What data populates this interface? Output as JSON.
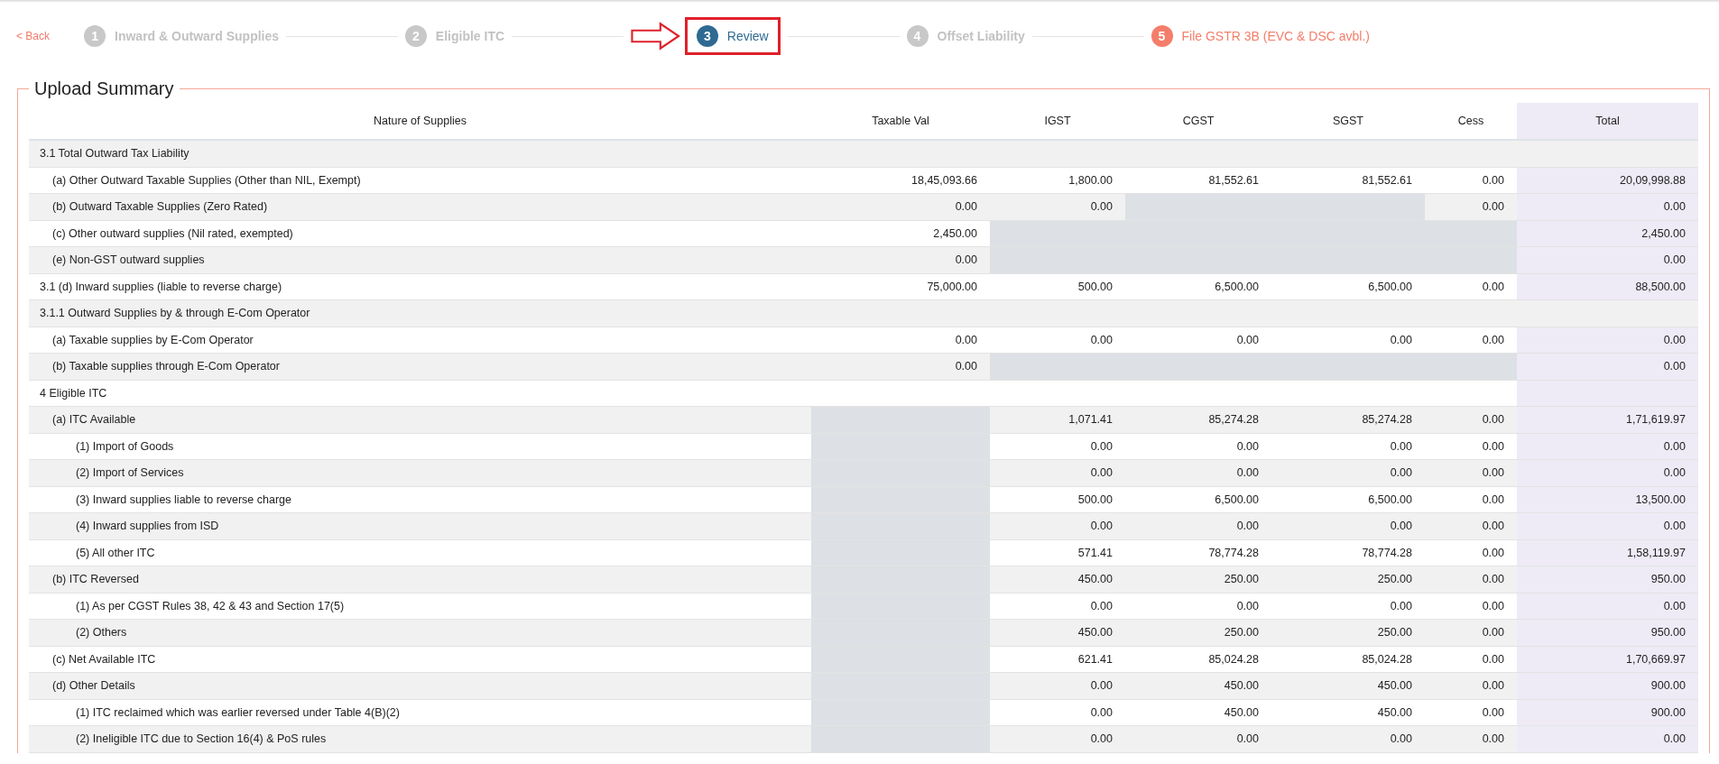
{
  "back": {
    "label": "< Back"
  },
  "steps": [
    {
      "number": "1",
      "label": "Inward & Outward Supplies",
      "kind": "pending",
      "highlighted": false
    },
    {
      "number": "2",
      "label": "Eligible ITC",
      "kind": "pending",
      "highlighted": false
    },
    {
      "number": "3",
      "label": "Review",
      "kind": "current",
      "highlighted": true
    },
    {
      "number": "4",
      "label": "Offset Liability",
      "kind": "pending",
      "highlighted": false
    },
    {
      "number": "5",
      "label": "File GSTR 3B (EVC & DSC avbl.)",
      "kind": "final",
      "highlighted": false
    }
  ],
  "summary": {
    "title": "Upload Summary",
    "columns": [
      "Nature of Supplies",
      "Taxable Val",
      "IGST",
      "CGST",
      "SGST",
      "Cess",
      "Total"
    ],
    "rows": [
      {
        "label": "3.1 Total Outward Tax Liability",
        "children": [
          {
            "label": "(a) Other Outward Taxable Supplies (Other than NIL, Exempt)",
            "cells": [
              {
                "text": "18,45,093.66",
                "disabled": false
              },
              {
                "text": "1,800.00",
                "disabled": false
              },
              {
                "text": "81,552.61",
                "disabled": false
              },
              {
                "text": "81,552.61",
                "disabled": false
              },
              {
                "text": "0.00",
                "disabled": false
              },
              {
                "text": "20,09,998.88",
                "disabled": false
              }
            ]
          },
          {
            "label": "(b) Outward Taxable Supplies (Zero Rated)",
            "cells": [
              {
                "text": "0.00",
                "disabled": false
              },
              {
                "text": "0.00",
                "disabled": false
              },
              {
                "disabled": true
              },
              {
                "disabled": true
              },
              {
                "text": "0.00",
                "disabled": false
              },
              {
                "text": "0.00",
                "disabled": false
              }
            ]
          },
          {
            "label": "(c) Other outward supplies (Nil rated, exempted)",
            "cells": [
              {
                "text": "2,450.00",
                "disabled": false
              },
              {
                "disabled": true
              },
              {
                "disabled": true
              },
              {
                "disabled": true
              },
              {
                "disabled": true
              },
              {
                "text": "2,450.00",
                "disabled": false
              }
            ]
          },
          {
            "label": "(e) Non-GST outward supplies",
            "cells": [
              {
                "text": "0.00",
                "disabled": false
              },
              {
                "disabled": true
              },
              {
                "disabled": true
              },
              {
                "disabled": true
              },
              {
                "disabled": true
              },
              {
                "text": "0.00",
                "disabled": false
              }
            ]
          }
        ]
      },
      {
        "label": "3.1 (d) Inward supplies (liable to reverse charge)",
        "cells": [
          {
            "text": "75,000.00",
            "disabled": false
          },
          {
            "text": "500.00",
            "disabled": false
          },
          {
            "text": "6,500.00",
            "disabled": false
          },
          {
            "text": "6,500.00",
            "disabled": false
          },
          {
            "text": "0.00",
            "disabled": false
          },
          {
            "text": "88,500.00",
            "disabled": false
          }
        ]
      },
      {
        "label": "3.1.1 Outward Supplies by & through E-Com Operator",
        "children": [
          {
            "label": "(a) Taxable supplies by E-Com Operator",
            "cells": [
              {
                "text": "0.00",
                "disabled": false
              },
              {
                "text": "0.00",
                "disabled": false
              },
              {
                "text": "0.00",
                "disabled": false
              },
              {
                "text": "0.00",
                "disabled": false
              },
              {
                "text": "0.00",
                "disabled": false
              },
              {
                "text": "0.00",
                "disabled": false
              }
            ]
          },
          {
            "label": "(b) Taxable supplies through E-Com Operator",
            "cells": [
              {
                "text": "0.00",
                "disabled": false
              },
              {
                "disabled": true
              },
              {
                "disabled": true
              },
              {
                "disabled": true
              },
              {
                "disabled": true
              },
              {
                "text": "0.00",
                "disabled": false
              }
            ]
          }
        ]
      },
      {
        "label": "4 Eligible ITC",
        "children": [
          {
            "label": "(a) ITC Available",
            "cells": [
              {
                "disabled": true
              },
              {
                "text": "1,071.41",
                "disabled": false
              },
              {
                "text": "85,274.28",
                "disabled": false
              },
              {
                "text": "85,274.28",
                "disabled": false
              },
              {
                "text": "0.00",
                "disabled": false
              },
              {
                "text": "1,71,619.97",
                "disabled": false
              }
            ],
            "children": [
              {
                "label": "(1) Import of Goods",
                "cells": [
                  {
                    "disabled": true
                  },
                  {
                    "text": "0.00",
                    "disabled": false
                  },
                  {
                    "text": "0.00",
                    "disabled": false
                  },
                  {
                    "text": "0.00",
                    "disabled": false
                  },
                  {
                    "text": "0.00",
                    "disabled": false
                  },
                  {
                    "text": "0.00",
                    "disabled": false
                  }
                ]
              },
              {
                "label": "(2) Import of Services",
                "cells": [
                  {
                    "disabled": true
                  },
                  {
                    "text": "0.00",
                    "disabled": false
                  },
                  {
                    "text": "0.00",
                    "disabled": false
                  },
                  {
                    "text": "0.00",
                    "disabled": false
                  },
                  {
                    "text": "0.00",
                    "disabled": false
                  },
                  {
                    "text": "0.00",
                    "disabled": false
                  }
                ]
              },
              {
                "label": "(3) Inward supplies liable to reverse charge",
                "cells": [
                  {
                    "disabled": true
                  },
                  {
                    "text": "500.00",
                    "disabled": false
                  },
                  {
                    "text": "6,500.00",
                    "disabled": false
                  },
                  {
                    "text": "6,500.00",
                    "disabled": false
                  },
                  {
                    "text": "0.00",
                    "disabled": false
                  },
                  {
                    "text": "13,500.00",
                    "disabled": false
                  }
                ]
              },
              {
                "label": "(4) Inward supplies from ISD",
                "cells": [
                  {
                    "disabled": true
                  },
                  {
                    "text": "0.00",
                    "disabled": false
                  },
                  {
                    "text": "0.00",
                    "disabled": false
                  },
                  {
                    "text": "0.00",
                    "disabled": false
                  },
                  {
                    "text": "0.00",
                    "disabled": false
                  },
                  {
                    "text": "0.00",
                    "disabled": false
                  }
                ]
              },
              {
                "label": "(5) All other ITC",
                "cells": [
                  {
                    "disabled": true
                  },
                  {
                    "text": "571.41",
                    "disabled": false
                  },
                  {
                    "text": "78,774.28",
                    "disabled": false
                  },
                  {
                    "text": "78,774.28",
                    "disabled": false
                  },
                  {
                    "text": "0.00",
                    "disabled": false
                  },
                  {
                    "text": "1,58,119.97",
                    "disabled": false
                  }
                ]
              }
            ]
          },
          {
            "label": "(b) ITC Reversed",
            "cells": [
              {
                "disabled": true
              },
              {
                "text": "450.00",
                "disabled": false
              },
              {
                "text": "250.00",
                "disabled": false
              },
              {
                "text": "250.00",
                "disabled": false
              },
              {
                "text": "0.00",
                "disabled": false
              },
              {
                "text": "950.00",
                "disabled": false
              }
            ],
            "children": [
              {
                "label": "(1) As per CGST Rules 38, 42 & 43 and Section 17(5)",
                "cells": [
                  {
                    "disabled": true
                  },
                  {
                    "text": "0.00",
                    "disabled": false
                  },
                  {
                    "text": "0.00",
                    "disabled": false
                  },
                  {
                    "text": "0.00",
                    "disabled": false
                  },
                  {
                    "text": "0.00",
                    "disabled": false
                  },
                  {
                    "text": "0.00",
                    "disabled": false
                  }
                ]
              },
              {
                "label": "(2) Others",
                "cells": [
                  {
                    "disabled": true
                  },
                  {
                    "text": "450.00",
                    "disabled": false
                  },
                  {
                    "text": "250.00",
                    "disabled": false
                  },
                  {
                    "text": "250.00",
                    "disabled": false
                  },
                  {
                    "text": "0.00",
                    "disabled": false
                  },
                  {
                    "text": "950.00",
                    "disabled": false
                  }
                ]
              }
            ]
          },
          {
            "label": "(c) Net Available ITC",
            "cells": [
              {
                "disabled": true
              },
              {
                "text": "621.41",
                "disabled": false
              },
              {
                "text": "85,024.28",
                "disabled": false
              },
              {
                "text": "85,024.28",
                "disabled": false
              },
              {
                "text": "0.00",
                "disabled": false
              },
              {
                "text": "1,70,669.97",
                "disabled": false
              }
            ]
          },
          {
            "label": "(d) Other Details",
            "cells": [
              {
                "disabled": true
              },
              {
                "text": "0.00",
                "disabled": false
              },
              {
                "text": "450.00",
                "disabled": false
              },
              {
                "text": "450.00",
                "disabled": false
              },
              {
                "text": "0.00",
                "disabled": false
              },
              {
                "text": "900.00",
                "disabled": false
              }
            ],
            "children": [
              {
                "label": "(1) ITC reclaimed which was earlier reversed under Table 4(B)(2)",
                "cells": [
                  {
                    "disabled": true
                  },
                  {
                    "text": "0.00",
                    "disabled": false
                  },
                  {
                    "text": "450.00",
                    "disabled": false
                  },
                  {
                    "text": "450.00",
                    "disabled": false
                  },
                  {
                    "text": "0.00",
                    "disabled": false
                  },
                  {
                    "text": "900.00",
                    "disabled": false
                  }
                ]
              },
              {
                "label": "(2) Ineligible ITC due to Section 16(4) & PoS rules",
                "cells": [
                  {
                    "disabled": true
                  },
                  {
                    "text": "0.00",
                    "disabled": false
                  },
                  {
                    "text": "0.00",
                    "disabled": false
                  },
                  {
                    "text": "0.00",
                    "disabled": false
                  },
                  {
                    "text": "0.00",
                    "disabled": false
                  },
                  {
                    "text": "0.00",
                    "disabled": false
                  }
                ]
              }
            ]
          }
        ]
      }
    ]
  }
}
